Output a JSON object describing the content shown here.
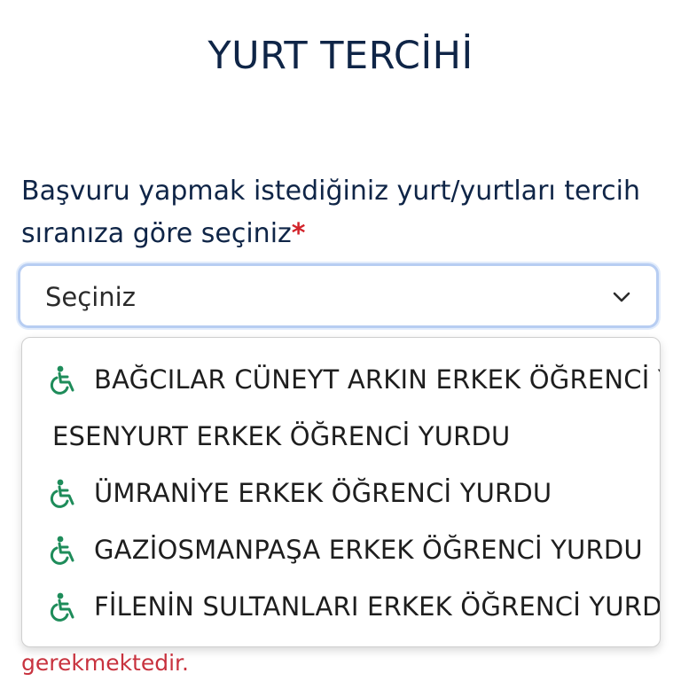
{
  "header": {
    "title": "YURT TERCİHİ"
  },
  "form": {
    "label": "Başvuru yapmak istediğiniz yurt/yurtları tercih sıranıza göre seçiniz",
    "required_marker": "*",
    "select_value": "Seçiniz",
    "footer_message": "gerekmektedir."
  },
  "dropdown": {
    "options": [
      {
        "label": "BAĞCILAR CÜNEYT ARKIN ERKEK ÖĞRENCİ YURDU",
        "accessible": true,
        "icon": "wheelchair-icon"
      },
      {
        "label": "ESENYURT ERKEK ÖĞRENCİ YURDU",
        "accessible": false
      },
      {
        "label": "ÜMRANİYE ERKEK ÖĞRENCİ YURDU",
        "accessible": true,
        "icon": "wheelchair-icon"
      },
      {
        "label": "GAZİOSMANPAŞA ERKEK ÖĞRENCİ YURDU",
        "accessible": true,
        "icon": "wheelchair-icon"
      },
      {
        "label": "FİLENİN SULTANLARI ERKEK ÖĞRENCİ YURDU",
        "accessible": true,
        "icon": "wheelchair-icon"
      }
    ]
  },
  "colors": {
    "title": "#0f2547",
    "required": "#d2232a",
    "accessible_icon": "#1e8c5a",
    "footer_error": "#c8323e",
    "select_border": "#b7cdf2"
  }
}
